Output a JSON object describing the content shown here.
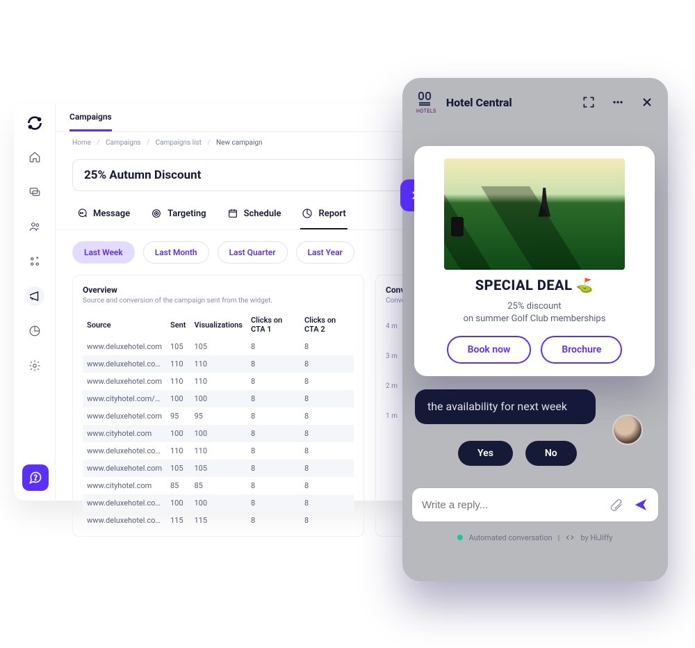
{
  "topbar": {
    "tab": "Campaigns"
  },
  "breadcrumbs": {
    "items": [
      "Home",
      "Campaigns",
      "Campaigns list"
    ],
    "current": "New campaign"
  },
  "page": {
    "title": "25% Autumn Discount"
  },
  "tabs": {
    "message": "Message",
    "targeting": "Targeting",
    "schedule": "Schedule",
    "report": "Report"
  },
  "pills": {
    "week": "Last Week",
    "month": "Last Month",
    "quarter": "Last Quarter",
    "year": "Last Year"
  },
  "overview": {
    "heading": "Overview",
    "sub": "Source and conversion of the campaign sent from the widget.",
    "columns": {
      "source": "Source",
      "sent": "Sent",
      "viz": "Visualizations",
      "cta1": "Clicks on CTA 1",
      "cta2": "Clicks on CTA 2"
    },
    "rows": [
      {
        "source": "www.deluxehotel.com",
        "sent": "105",
        "viz": "105",
        "cta1": "8",
        "cta2": "8"
      },
      {
        "source": "www.deluxehotel.com/r...",
        "sent": "110",
        "viz": "110",
        "cta1": "8",
        "cta2": "8"
      },
      {
        "source": "www.deluxehotel.com",
        "sent": "110",
        "viz": "110",
        "cta1": "8",
        "cta2": "8"
      },
      {
        "source": "www.cityhotel.com/roo...",
        "sent": "100",
        "viz": "100",
        "cta1": "8",
        "cta2": "8"
      },
      {
        "source": "www.deluxehotel.com",
        "sent": "95",
        "viz": "95",
        "cta1": "8",
        "cta2": "8"
      },
      {
        "source": "www.cityhotel.com",
        "sent": "100",
        "viz": "100",
        "cta1": "8",
        "cta2": "8"
      },
      {
        "source": "www.deluxehotel.com/p...",
        "sent": "110",
        "viz": "110",
        "cta1": "8",
        "cta2": "8"
      },
      {
        "source": "www.deluxehotel.com",
        "sent": "105",
        "viz": "105",
        "cta1": "8",
        "cta2": "8"
      },
      {
        "source": "www.cityhotel.com",
        "sent": "85",
        "viz": "85",
        "cta1": "8",
        "cta2": "8"
      },
      {
        "source": "www.deluxehotel.com/a...",
        "sent": "100",
        "viz": "100",
        "cta1": "8",
        "cta2": "8"
      },
      {
        "source": "www.deluxehotel.com/p...",
        "sent": "115",
        "viz": "115",
        "cta1": "8",
        "cta2": "8"
      }
    ]
  },
  "conv": {
    "heading": "Conv",
    "sub": "Conve",
    "yticks": [
      "4 m",
      "3 m",
      "2 m",
      "1 m"
    ]
  },
  "widget": {
    "brand_small": "HOTELS",
    "title": "Hotel Central",
    "bubble": "the availability for next week",
    "qr": {
      "yes": "Yes",
      "no": "No"
    },
    "input_placeholder": "Write a reply...",
    "footer": {
      "text": "Automated conversation",
      "by": "by HiJiffy"
    }
  },
  "deal": {
    "heading": "SPECIAL DEAL ⛳",
    "line1": "25% discount",
    "line2": "on summer Golf Club memberships",
    "book": "Book now",
    "brochure": "Brochure"
  }
}
